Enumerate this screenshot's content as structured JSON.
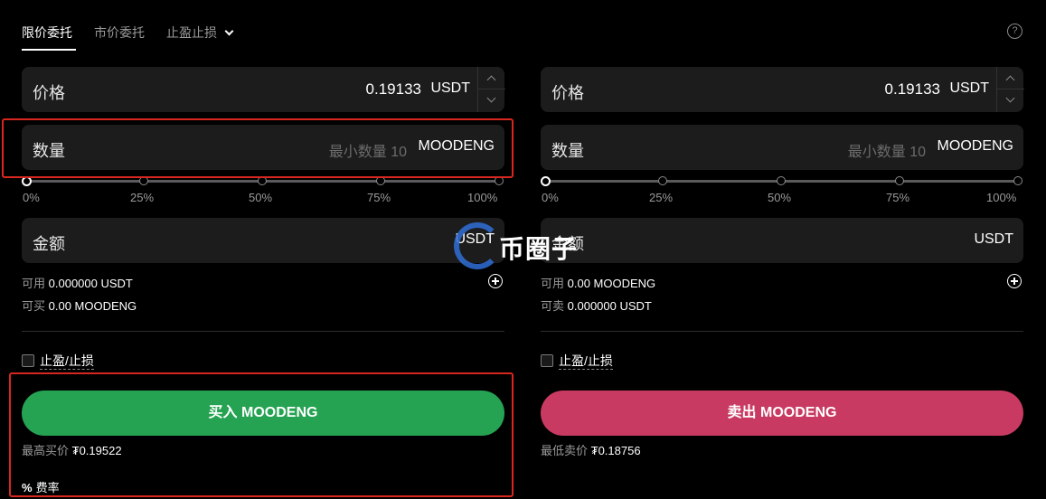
{
  "tabs": [
    {
      "label": "限价委托",
      "active": true
    },
    {
      "label": "市价委托",
      "active": false
    },
    {
      "label": "止盈止损",
      "active": false
    }
  ],
  "help_icon": "?",
  "buy": {
    "price_label": "价格",
    "price_value": "0.19133",
    "price_unit": "USDT",
    "qty_label": "数量",
    "qty_placeholder": "最小数量 10",
    "qty_unit": "MOODENG",
    "slider_ticks": [
      "0%",
      "25%",
      "50%",
      "75%",
      "100%"
    ],
    "amount_label": "金额",
    "amount_unit": "USDT",
    "available_label": "可用",
    "available_value": "0.000000 USDT",
    "can_label": "可买",
    "can_value": "0.00 MOODENG",
    "tpsl_label": "止盈/止损",
    "button_label": "买入 MOODENG",
    "best_label": "最高买价",
    "best_value": "₮0.19522",
    "fee_icon": "%",
    "fee_label": "费率"
  },
  "sell": {
    "price_label": "价格",
    "price_value": "0.19133",
    "price_unit": "USDT",
    "qty_label": "数量",
    "qty_placeholder": "最小数量 10",
    "qty_unit": "MOODENG",
    "slider_ticks": [
      "0%",
      "25%",
      "50%",
      "75%",
      "100%"
    ],
    "amount_label": "金额",
    "amount_unit": "USDT",
    "available_label": "可用",
    "available_value": "0.00 MOODENG",
    "can_label": "可卖",
    "can_value": "0.000000 USDT",
    "tpsl_label": "止盈/止损",
    "button_label": "卖出 MOODENG",
    "best_label": "最低卖价",
    "best_value": "₮0.18756"
  },
  "watermark": {
    "text": "币圈子"
  },
  "colors": {
    "buy": "#25a352",
    "sell": "#c93a62",
    "highlight": "#d8271f",
    "field_bg": "#1c1c1c"
  }
}
